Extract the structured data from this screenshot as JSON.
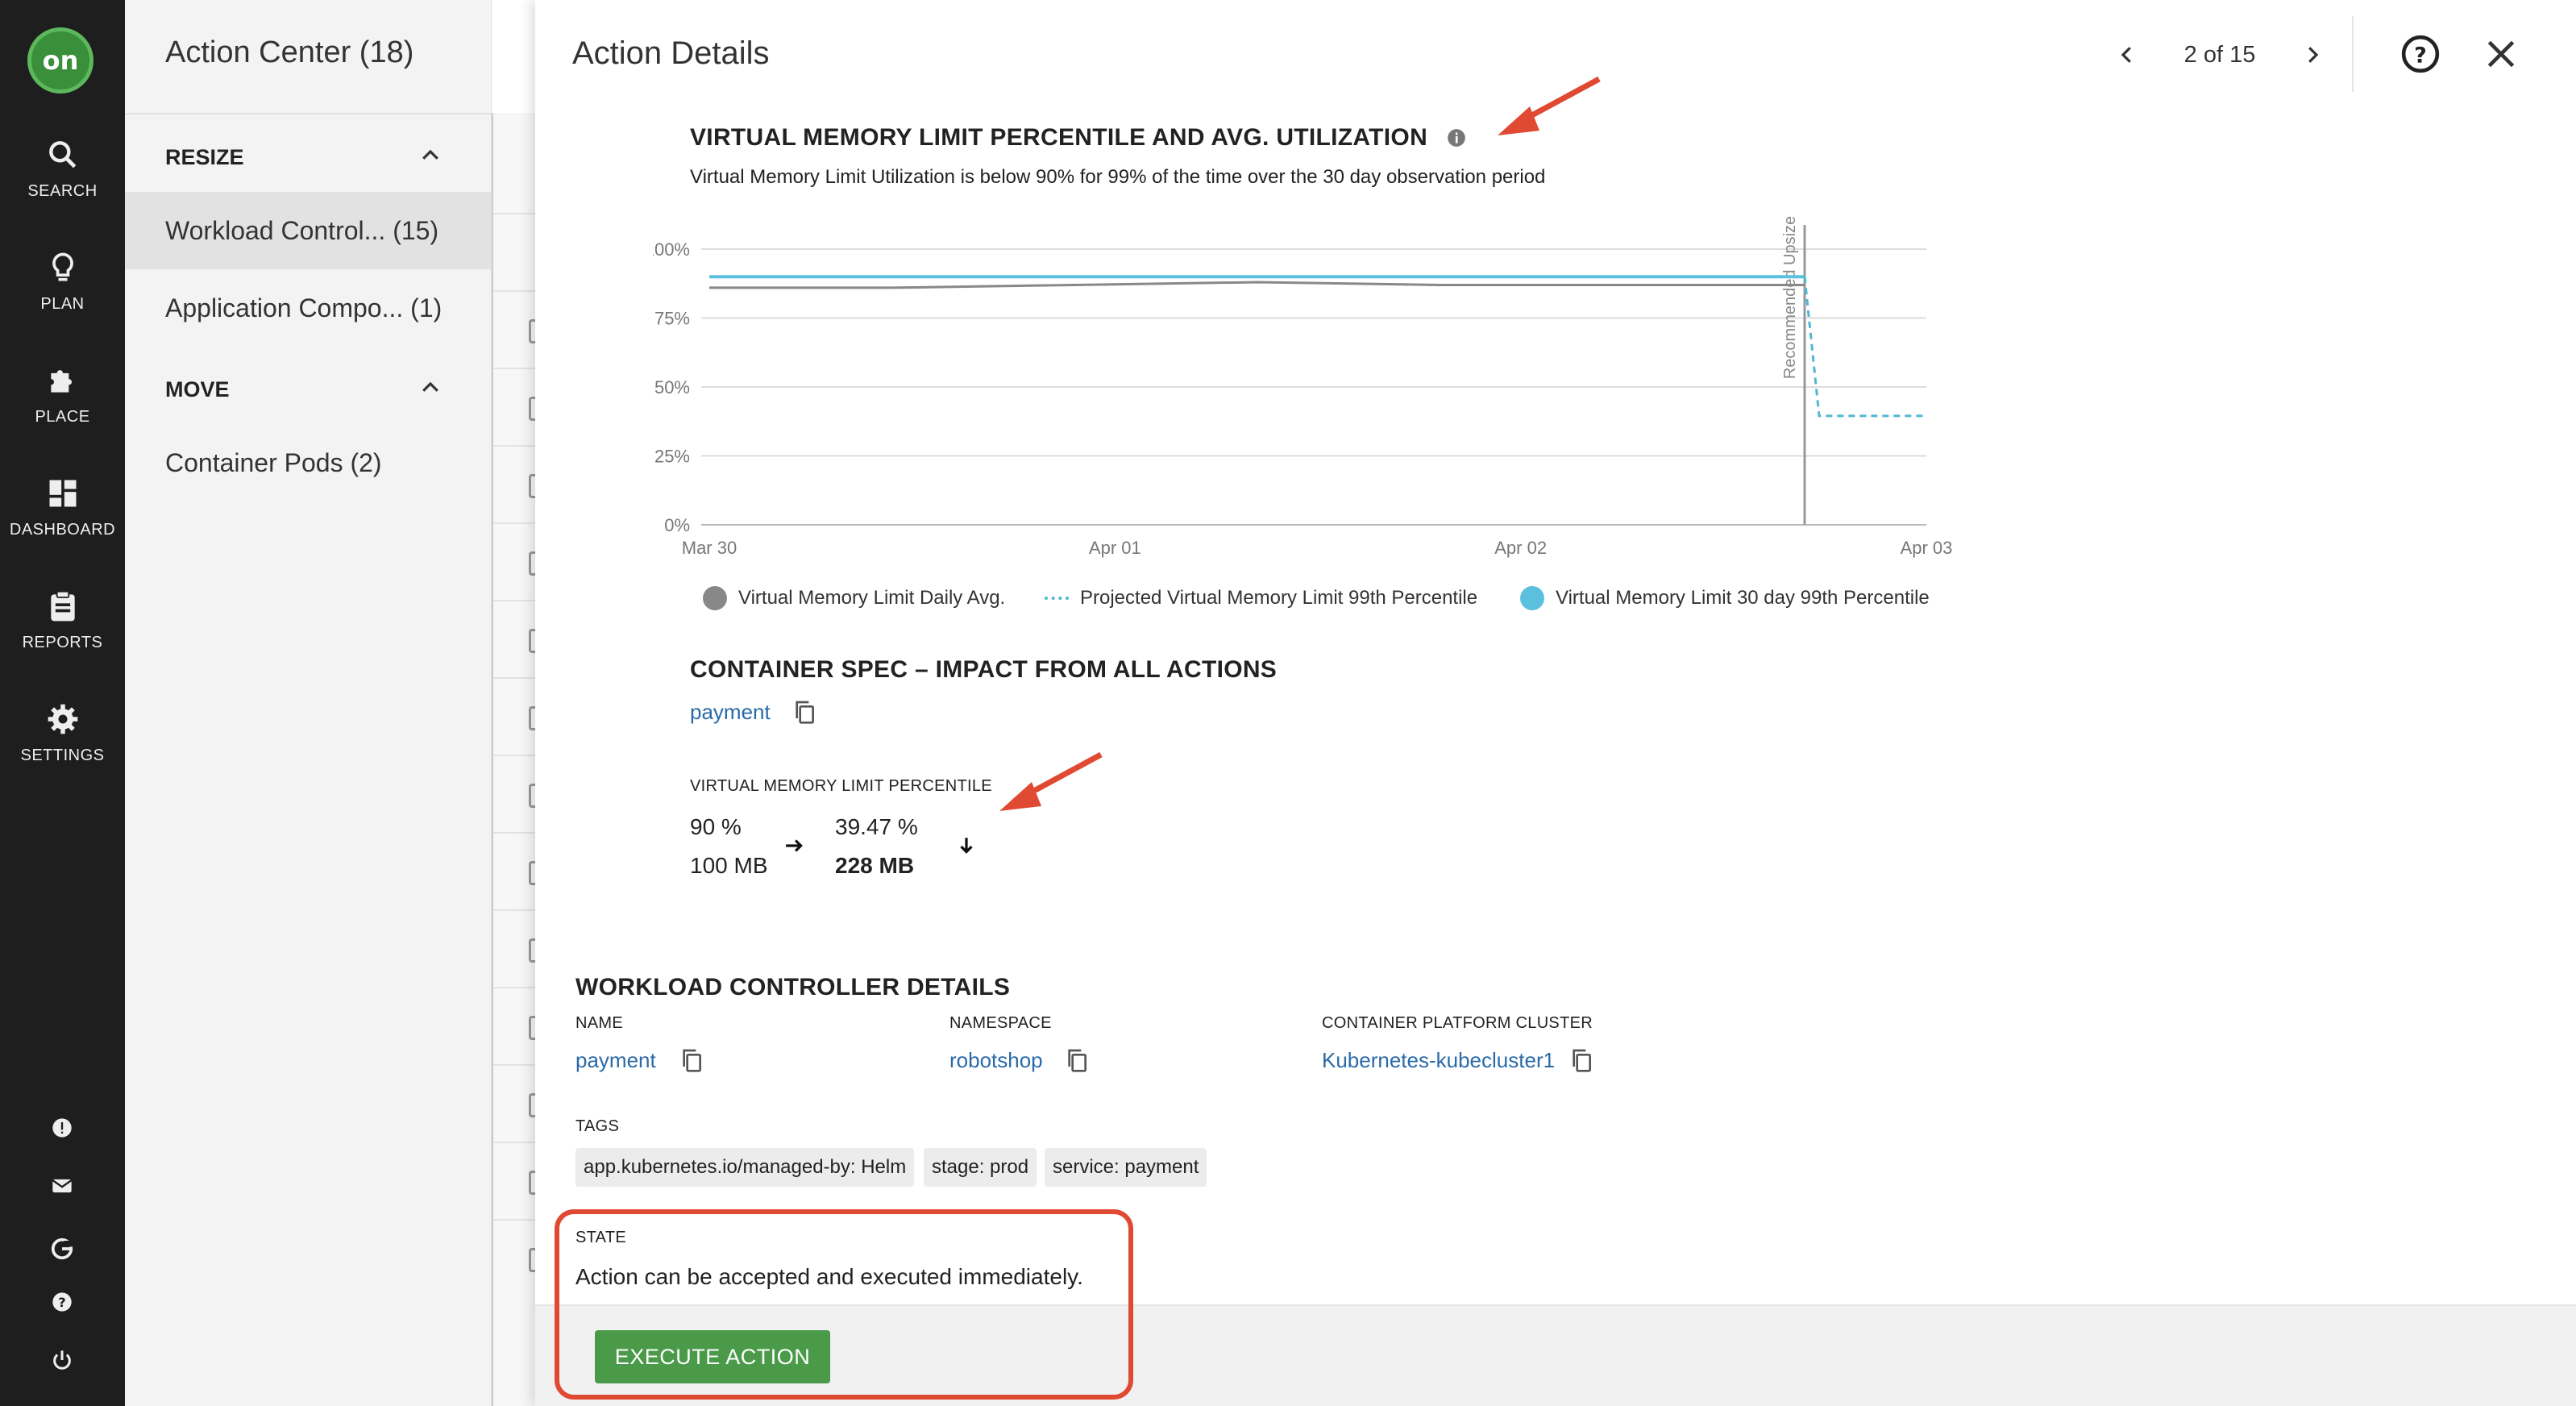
{
  "nav": {
    "items": [
      {
        "label": "SEARCH",
        "icon": "search-icon"
      },
      {
        "label": "PLAN",
        "icon": "lightbulb-icon"
      },
      {
        "label": "PLACE",
        "icon": "puzzle-icon"
      },
      {
        "label": "DASHBOARD",
        "icon": "dashboard-icon"
      },
      {
        "label": "REPORTS",
        "icon": "clipboard-icon"
      },
      {
        "label": "SETTINGS",
        "icon": "gear-icon"
      }
    ],
    "logo_text": "on",
    "bottom_icons": [
      "alert-icon",
      "mail-icon",
      "google-icon",
      "help-icon",
      "power-icon"
    ]
  },
  "action_center": {
    "title": "Action Center (18)",
    "resize_label": "RESIZE",
    "move_label": "MOVE",
    "items": [
      {
        "label": "Workload Control... (15)"
      },
      {
        "label": "Application Compo... (1)"
      },
      {
        "label": "Container Pods (2)"
      }
    ]
  },
  "modal": {
    "title": "Action Details",
    "pager": "2 of 15",
    "chart_section": {
      "title": "VIRTUAL MEMORY LIMIT PERCENTILE AND AVG. UTILIZATION",
      "subtitle": "Virtual Memory Limit Utilization is below 90% for 99% of the time over the 30 day observation period",
      "marker_label": "Recommended Upsize"
    },
    "legend": [
      {
        "label": "Virtual Memory Limit Daily Avg.",
        "color": "#888888"
      },
      {
        "label": "Projected Virtual Memory Limit 99th Percentile",
        "color": "#4fb6d4"
      },
      {
        "label": "Virtual Memory Limit 30 day 99th Percentile",
        "color": "#5bc0de"
      }
    ],
    "container_spec": {
      "title": "CONTAINER SPEC – IMPACT FROM ALL ACTIONS",
      "link": "payment",
      "metric_label": "VIRTUAL MEMORY LIMIT PERCENTILE",
      "from_pct": "90 %",
      "from_mb": "100 MB",
      "to_pct": "39.47 %",
      "to_mb": "228 MB"
    },
    "workload": {
      "title": "WORKLOAD CONTROLLER DETAILS",
      "name_label": "NAME",
      "name_value": "payment",
      "namespace_label": "NAMESPACE",
      "namespace_value": "robotshop",
      "cluster_label": "CONTAINER PLATFORM CLUSTER",
      "cluster_value": "Kubernetes-kubecluster1",
      "tags_label": "TAGS",
      "tags": [
        "app.kubernetes.io/managed-by: Helm",
        "stage: prod",
        "service: payment"
      ]
    },
    "state": {
      "label": "STATE",
      "text": "Action can be accepted and executed immediately.",
      "button": "EXECUTE ACTION"
    }
  },
  "chart_data": {
    "type": "line",
    "x": [
      "Mar 30",
      "Mar 31",
      "Apr 01",
      "Apr 01.5",
      "Apr 02",
      "Apr 02.5",
      "Apr 03"
    ],
    "x_ticks": [
      "Mar 30",
      "Apr 01",
      "Apr 02",
      "Apr 03"
    ],
    "y_ticks": [
      "0%",
      "25%",
      "50%",
      "75%",
      "100%"
    ],
    "ylim": [
      0,
      100
    ],
    "series": [
      {
        "name": "Virtual Memory Limit Daily Avg.",
        "values": [
          86,
          86,
          87,
          88,
          87,
          87,
          87
        ]
      },
      {
        "name": "Virtual Memory Limit 30 day 99th Percentile",
        "values": [
          90,
          90,
          90,
          90,
          90,
          90,
          90
        ]
      },
      {
        "name": "Projected Virtual Memory Limit 99th Percentile",
        "points": [
          [
            "marker",
            90
          ],
          [
            "after",
            39.5
          ],
          [
            "end",
            39.5
          ]
        ]
      }
    ],
    "marker": {
      "label": "Recommended Upsize"
    },
    "legend_position": "bottom"
  }
}
